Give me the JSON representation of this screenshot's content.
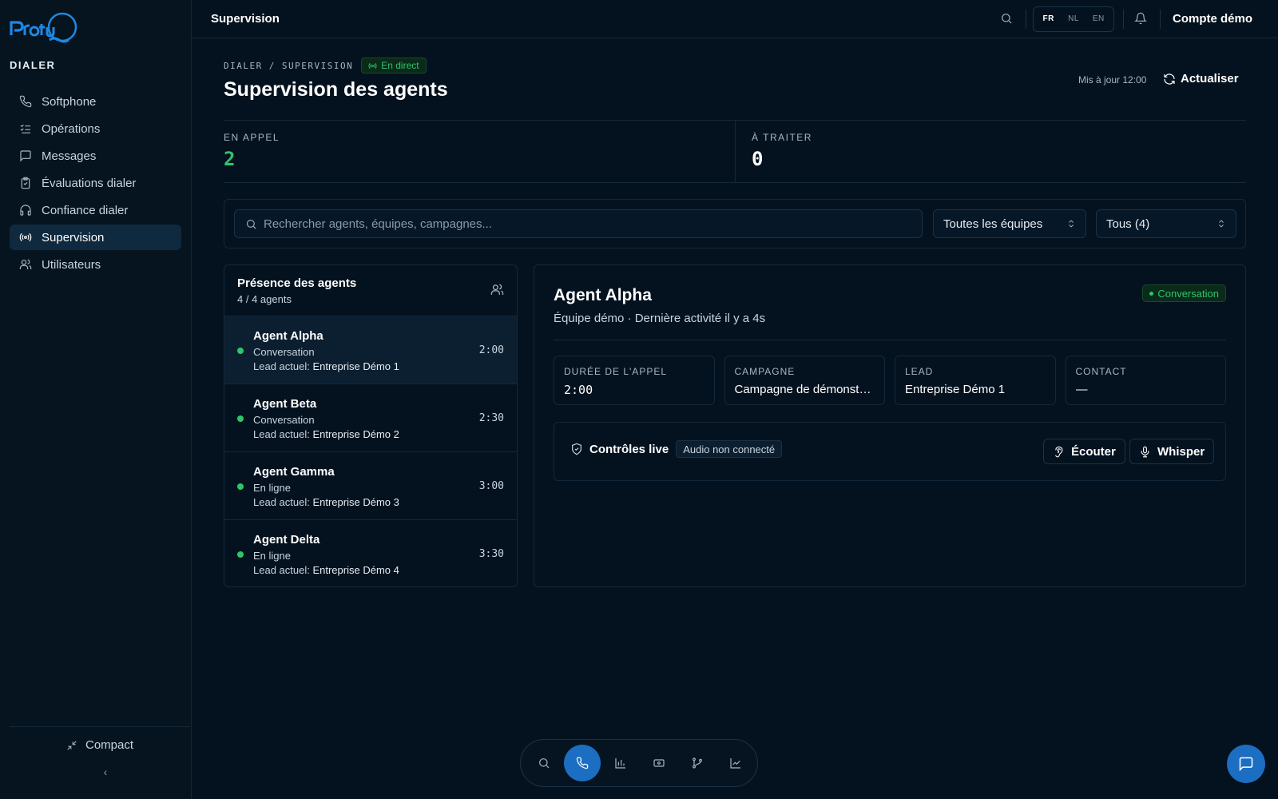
{
  "sidebar": {
    "section_label": "DIALER",
    "items": [
      {
        "label": "Softphone",
        "icon": "phone-icon"
      },
      {
        "label": "Opérations",
        "icon": "list-check-icon"
      },
      {
        "label": "Messages",
        "icon": "message-icon"
      },
      {
        "label": "Évaluations dialer",
        "icon": "clipboard-icon"
      },
      {
        "label": "Confiance dialer",
        "icon": "headset-icon"
      },
      {
        "label": "Supervision",
        "icon": "broadcast-icon",
        "active": true
      },
      {
        "label": "Utilisateurs",
        "icon": "users-icon"
      }
    ],
    "compact_label": "Compact",
    "collapse_glyph": "‹"
  },
  "topbar": {
    "title": "Supervision",
    "languages": [
      "FR",
      "NL",
      "EN"
    ],
    "active_language": "FR",
    "account": "Compte démo"
  },
  "header": {
    "breadcrumb": [
      "DIALER",
      "SUPERVISION"
    ],
    "breadcrumb_sep": "/",
    "live_label": "En direct",
    "title": "Supervision des agents",
    "updated": "Mis à jour 12:00",
    "refresh_label": "Actualiser"
  },
  "stats": [
    {
      "label": "EN APPEL",
      "value": "2",
      "color": "#31c46b"
    },
    {
      "label": "À TRAITER",
      "value": "0",
      "color": "#ffffff"
    }
  ],
  "filters": {
    "search_placeholder": "Rechercher agents, équipes, campagnes...",
    "team_select": "Toutes les équipes",
    "status_select": "Tous (4)"
  },
  "presence": {
    "title": "Présence des agents",
    "count": "4 / 4 agents",
    "lead_prefix": "Lead actuel:",
    "agents": [
      {
        "name": "Agent Alpha",
        "status": "Conversation",
        "lead": "Entreprise Démo 1",
        "time": "2:00"
      },
      {
        "name": "Agent Beta",
        "status": "Conversation",
        "lead": "Entreprise Démo 2",
        "time": "2:30"
      },
      {
        "name": "Agent Gamma",
        "status": "En ligne",
        "lead": "Entreprise Démo 3",
        "time": "3:00"
      },
      {
        "name": "Agent Delta",
        "status": "En ligne",
        "lead": "Entreprise Démo 4",
        "time": "3:30"
      }
    ]
  },
  "detail": {
    "name": "Agent Alpha",
    "subtitle": "Équipe démo · Dernière activité il y a 4s",
    "status": "Conversation",
    "cards": [
      {
        "label": "DURÉE DE L'APPEL",
        "value": "2:00"
      },
      {
        "label": "CAMPAGNE",
        "value": "Campagne de démonstrat..."
      },
      {
        "label": "LEAD",
        "value": "Entreprise Démo 1"
      },
      {
        "label": "CONTACT",
        "value": "—"
      }
    ],
    "controls_title": "Contrôles live",
    "audio_badge": "Audio non connecté",
    "listen_label": "Écouter",
    "whisper_label": "Whisper"
  },
  "dock": {
    "icons": [
      "search-icon",
      "phone-icon",
      "bar-chart-icon",
      "ticket-icon",
      "git-branch-icon",
      "line-chart-icon"
    ],
    "active": "phone-icon"
  },
  "colors": {
    "background": "#04121f",
    "accent": "#1b6ec2",
    "success": "#31c46b"
  }
}
